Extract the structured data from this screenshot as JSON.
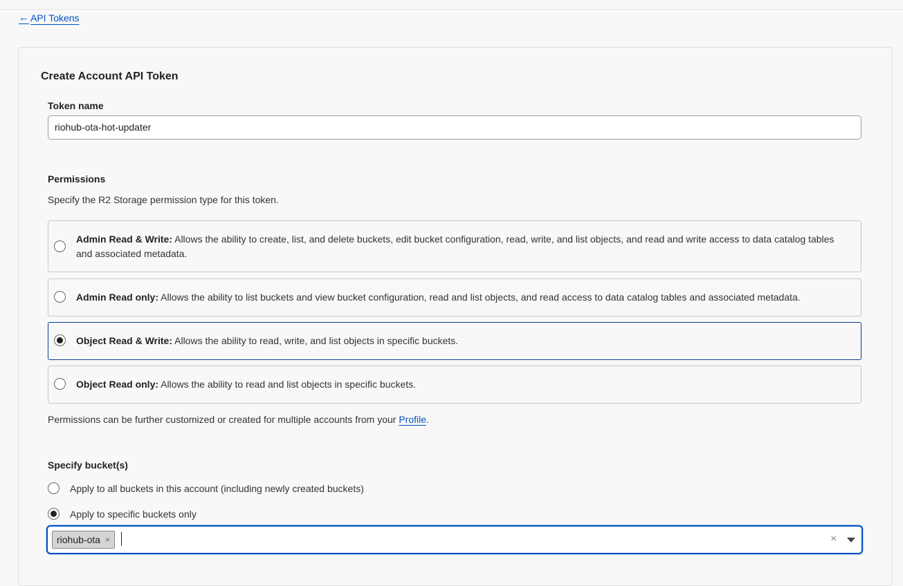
{
  "nav": {
    "back_label": "API Tokens"
  },
  "form": {
    "title": "Create Account API Token",
    "token_name_label": "Token name",
    "token_name_value": "riohub-ota-hot-updater",
    "permissions_label": "Permissions",
    "permissions_desc": "Specify the R2 Storage permission type for this token.",
    "permission_options": [
      {
        "name": "Admin Read & Write:",
        "desc": "Allows the ability to create, list, and delete buckets, edit bucket configuration, read, write, and list objects, and read and write access to data catalog tables and associated metadata.",
        "selected": false
      },
      {
        "name": "Admin Read only:",
        "desc": "Allows the ability to list buckets and view bucket configuration, read and list objects, and read access to data catalog tables and associated metadata.",
        "selected": false
      },
      {
        "name": "Object Read & Write:",
        "desc": "Allows the ability to read, write, and list objects in specific buckets.",
        "selected": true
      },
      {
        "name": "Object Read only:",
        "desc": "Allows the ability to read and list objects in specific buckets.",
        "selected": false
      }
    ],
    "permissions_note_prefix": "Permissions can be further customized or created for multiple accounts from your",
    "permissions_note_link": "Profile",
    "permissions_note_suffix": ".",
    "bucket_label": "Specify bucket(s)",
    "bucket_options": [
      {
        "label": "Apply to all buckets in this account (including newly created buckets)",
        "selected": false
      },
      {
        "label": "Apply to specific buckets only",
        "selected": true
      }
    ],
    "selected_buckets": [
      "riohub-ota"
    ],
    "chip_remove_glyph": "×",
    "clear_glyph": "×"
  }
}
